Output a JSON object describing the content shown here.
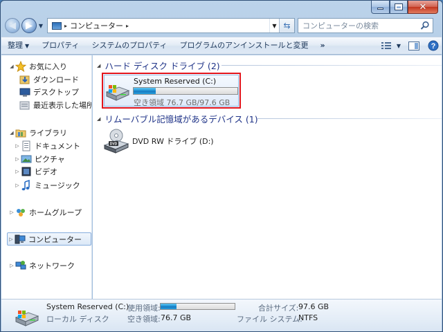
{
  "window": {
    "caption_buttons": {
      "minimize": "minimize",
      "maximize": "maximize",
      "close": "✕"
    }
  },
  "address": {
    "breadcrumb": "コンピューター",
    "separator": "▸",
    "search_placeholder": "コンピューターの検索"
  },
  "toolbar": {
    "organize": "整理",
    "properties": "プロパティ",
    "system_properties": "システムのプロパティ",
    "uninstall": "プログラムのアンインストールと変更",
    "more": "»"
  },
  "nav": {
    "favorites": "お気に入り",
    "downloads": "ダウンロード",
    "desktop": "デスクトップ",
    "recent": "最近表示した場所",
    "libraries": "ライブラリ",
    "documents": "ドキュメント",
    "pictures": "ピクチャ",
    "videos": "ビデオ",
    "music": "ミュージック",
    "homegroup": "ホームグループ",
    "computer": "コンピューター",
    "network": "ネットワーク"
  },
  "content": {
    "hdd_group": "ハード ディスク ドライブ (2)",
    "removable_group": "リムーバブル記憶域があるデバイス (1)",
    "drive_c": {
      "name": "System Reserved (C:)",
      "free_text": "空き領域 76.7 GB/97.6 GB",
      "used_fraction": 0.214
    },
    "dvd": {
      "name": "DVD RW ドライブ (D:)"
    }
  },
  "details": {
    "name": "System Reserved (C:)",
    "type": "ローカル ディスク",
    "used_label": "使用領域:",
    "free_label": "空き領域:",
    "free_value": "76.7 GB",
    "total_label": "合計サイズ:",
    "total_value": "97.6 GB",
    "fs_label": "ファイル システム:",
    "fs_value": "NTFS",
    "used_fraction": 0.214
  },
  "colors": {
    "selection_border": "#e3151c",
    "group_header": "#1e3287",
    "bar_fill": "#1b8fd3"
  }
}
